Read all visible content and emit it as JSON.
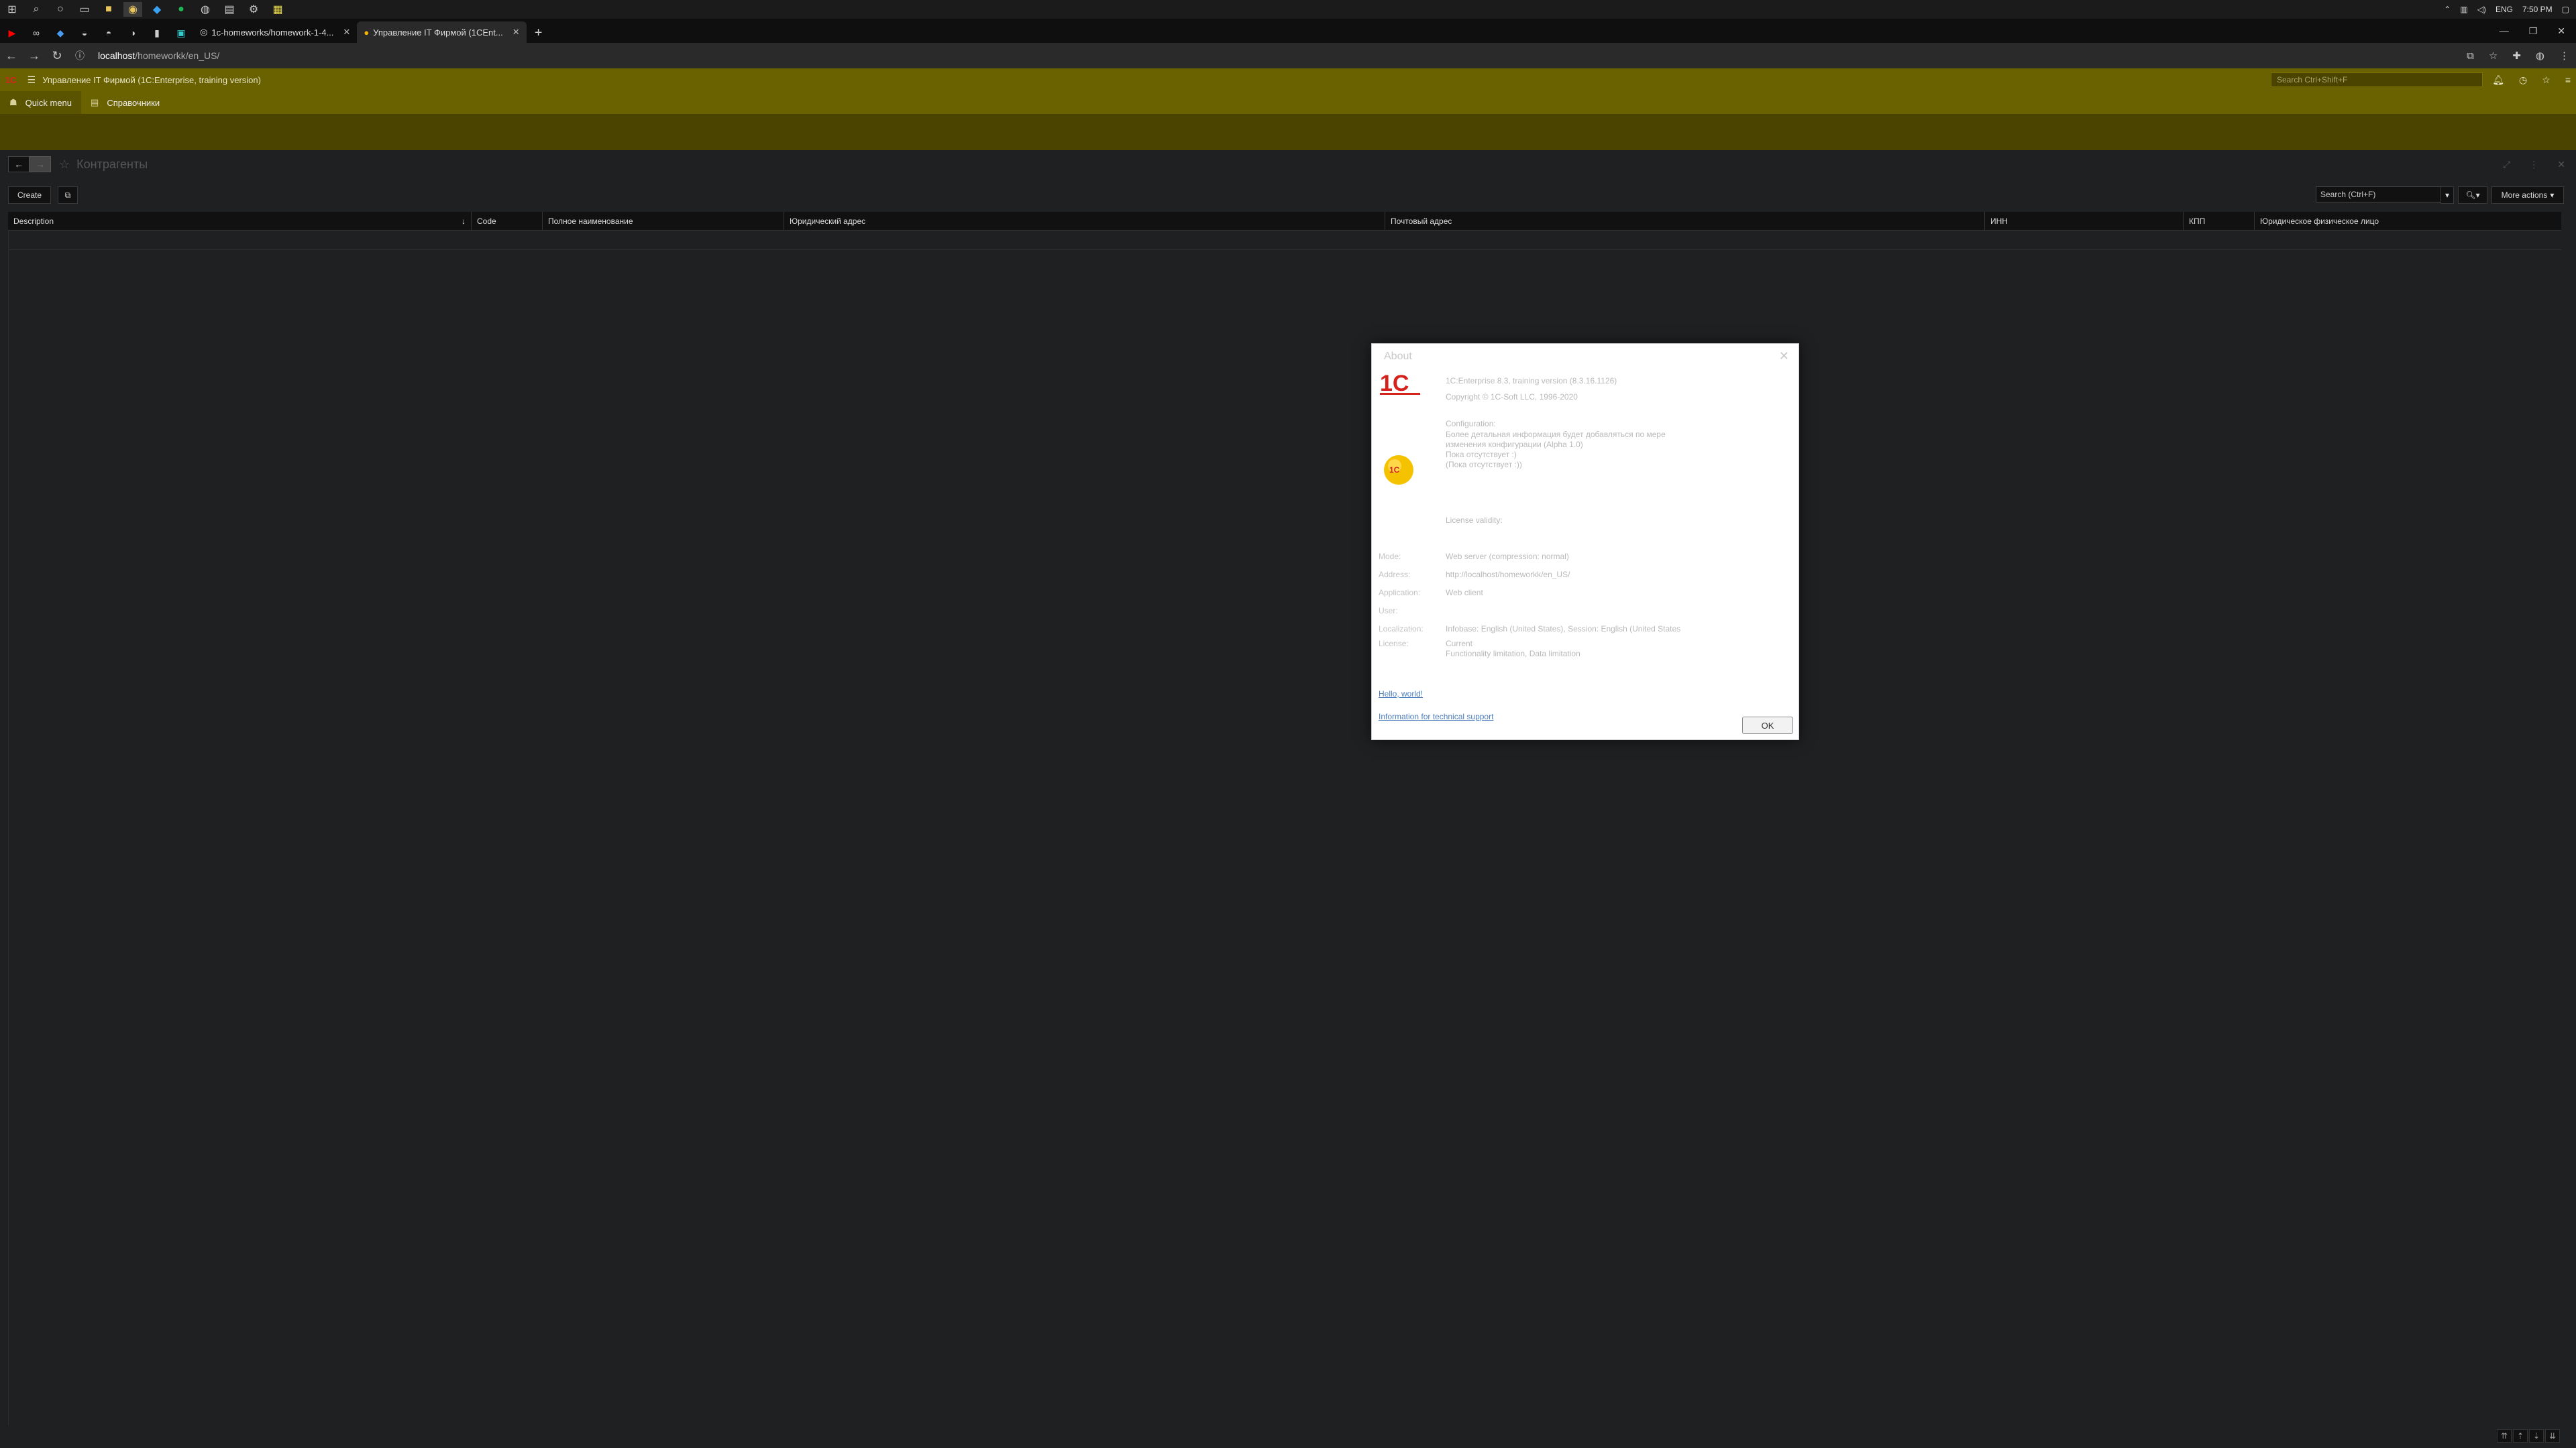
{
  "taskbar": {
    "icons": [
      "windows-icon",
      "search-icon",
      "cortana-icon",
      "task-view-icon",
      "file-explorer-icon",
      "chrome-icon",
      "vscode-icon",
      "spotify-icon",
      "steam-icon",
      "terminal-icon",
      "settings-icon",
      "notes-icon"
    ],
    "tray": {
      "language": "ENG",
      "time": "7:50 PM"
    }
  },
  "browser": {
    "tabs": [
      {
        "label": "1c-homeworks/homework-1-4...",
        "active": false
      },
      {
        "label": "Управление IT Фирмой (1CEnt...",
        "active": true
      }
    ],
    "new_tab": "+",
    "url_host": "localhost",
    "url_path": "/homeworkk/en_US/"
  },
  "app": {
    "title": "Управление IT Фирмой  (1C:Enterprise, training version)",
    "search_placeholder": "Search Ctrl+Shift+F",
    "sections": [
      {
        "label": "Quick menu"
      },
      {
        "label": "Справочники"
      }
    ]
  },
  "form": {
    "title": "Контрагенты",
    "create_label": "Create",
    "search_placeholder": "Search (Ctrl+F)",
    "more_actions_label": "More actions",
    "columns": [
      "Description",
      "Code",
      "Полное наименование",
      "Юридический адрес",
      "Почтовый адрес",
      "ИНН",
      "КПП",
      "Юридическое физическое лицо"
    ],
    "sort_indicator": "↓"
  },
  "about": {
    "title": "About",
    "version": "1C:Enterprise 8.3, training version (8.3.16.1126)",
    "copyright": "Copyright © 1C-Soft LLC, 1996-2020",
    "configuration_label": "Configuration:",
    "config_lines": [
      "Более детальная информация будет добавляться по мере",
      "изменения конфигурации (Alpha 1.0)",
      "Пока отсутствует :)",
      "(Пока отсутствует :))"
    ],
    "license_validity": "License validity:",
    "rows": [
      {
        "label": "Mode:",
        "value": "Web server (compression: normal)"
      },
      {
        "label": "Address:",
        "value": "http://localhost/homeworkk/en_US/"
      },
      {
        "label": "Application:",
        "value": "Web client"
      },
      {
        "label": "User:",
        "value": ""
      },
      {
        "label": "Localization:",
        "value": "Infobase: English (United States), Session: English (United States"
      },
      {
        "label": "License:",
        "value": "Current"
      }
    ],
    "license_extra": "Functionality limitation, Data limitation",
    "link_hello": "Hello, world!",
    "link_support": "Information for technical support",
    "ok_label": "OK"
  }
}
